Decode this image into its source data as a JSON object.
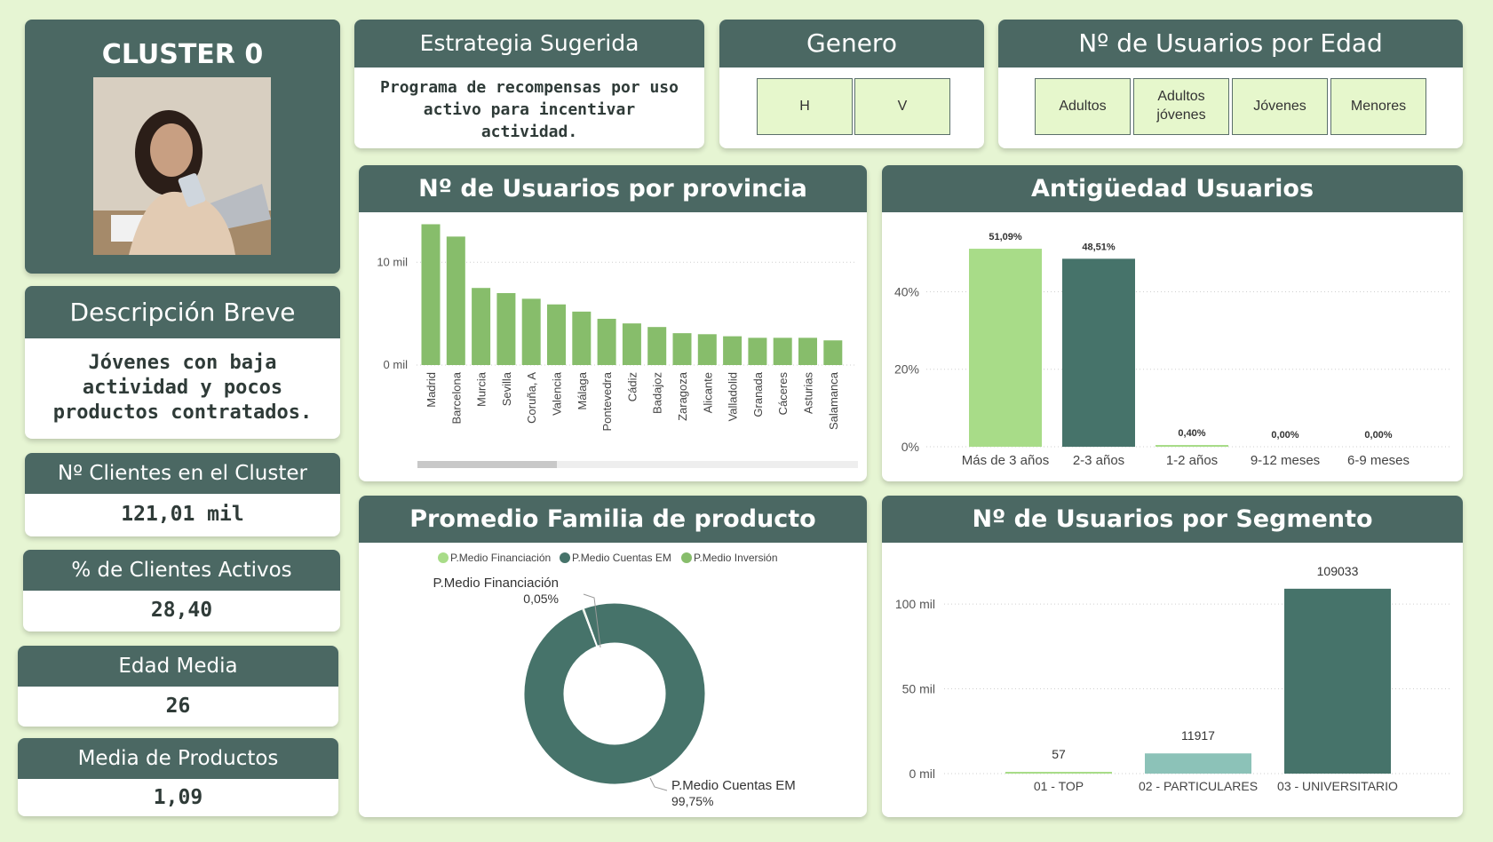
{
  "cluster": {
    "title": "CLUSTER 0"
  },
  "description": {
    "title": "Descripción Breve",
    "text": "Jóvenes con baja actividad y pocos productos contratados."
  },
  "kpis": [
    {
      "label": "Nº Clientes en el Cluster",
      "value": "121,01 mil"
    },
    {
      "label": "% de Clientes Activos",
      "value": "28,40"
    },
    {
      "label": "Edad Media",
      "value": "26"
    },
    {
      "label": "Media de Productos",
      "value": "1,09"
    }
  ],
  "strategy": {
    "title": "Estrategia Sugerida",
    "text": "Programa de recompensas por uso activo para incentivar actividad."
  },
  "genero": {
    "title": "Genero",
    "options": [
      "H",
      "V"
    ]
  },
  "edad": {
    "title": "Nº de Usuarios por Edad",
    "options": [
      "Adultos",
      "Adultos jóvenes",
      "Jóvenes",
      "Menores"
    ]
  },
  "colors": {
    "header": "#4b6863",
    "light_green": "#a8dc88",
    "bar_green": "#87bd6b",
    "dark_green": "#46736a",
    "teal_light": "#8cc2b8",
    "background": "#e6f5d3"
  },
  "chart_data": [
    {
      "type": "bar",
      "title": "Nº de Usuarios por provincia",
      "categories": [
        "Madrid",
        "Barcelona",
        "Murcia",
        "Sevilla",
        "Coruña, A",
        "Valencia",
        "Málaga",
        "Pontevedra",
        "Cádiz",
        "Badajoz",
        "Zaragoza",
        "Alicante",
        "Valladolid",
        "Granada",
        "Cáceres",
        "Asturias",
        "Salamanca"
      ],
      "values": [
        13700,
        12500,
        7500,
        7000,
        6450,
        5900,
        5200,
        4500,
        4050,
        3700,
        3100,
        3000,
        2800,
        2650,
        2650,
        2650,
        2400
      ],
      "yticks": [
        "10 mil",
        "0 mil"
      ],
      "ylim": [
        0,
        14000
      ],
      "grid": true
    },
    {
      "type": "bar",
      "title": "Antigüedad Usuarios",
      "categories": [
        "Más de 3 años",
        "2-3 años",
        "1-2 años",
        "9-12 meses",
        "6-9 meses"
      ],
      "values": [
        51.09,
        48.51,
        0.4,
        0.0,
        0.0
      ],
      "data_labels": [
        "51,09%",
        "48,51%",
        "0,40%",
        "0,00%",
        "0,00%"
      ],
      "yticks": [
        "40%",
        "20%",
        "0%"
      ],
      "ylim": [
        0,
        55
      ],
      "grid": true
    },
    {
      "type": "pie",
      "title": "Promedio Familia de producto",
      "legend": [
        "P.Medio Financiación",
        "P.Medio Cuentas EM",
        "P.Medio Inversión"
      ],
      "slices": [
        {
          "label": "P.Medio Financiación",
          "value": 0.05,
          "display": "0,05%"
        },
        {
          "label": "P.Medio Cuentas EM",
          "value": 99.75,
          "display": "99,75%"
        },
        {
          "label": "P.Medio Inversión",
          "value": 0.2,
          "display": ""
        }
      ],
      "legend_position": "top"
    },
    {
      "type": "bar",
      "title": "Nº de Usuarios por Segmento",
      "categories": [
        "01 - TOP",
        "02 - PARTICULARES",
        "03 - UNIVERSITARIO"
      ],
      "values": [
        57,
        11917,
        109033
      ],
      "data_labels": [
        "57",
        "11917",
        "109033"
      ],
      "yticks": [
        "100 mil",
        "50 mil",
        "0 mil"
      ],
      "ylim": [
        0,
        110000
      ],
      "grid": true
    }
  ]
}
